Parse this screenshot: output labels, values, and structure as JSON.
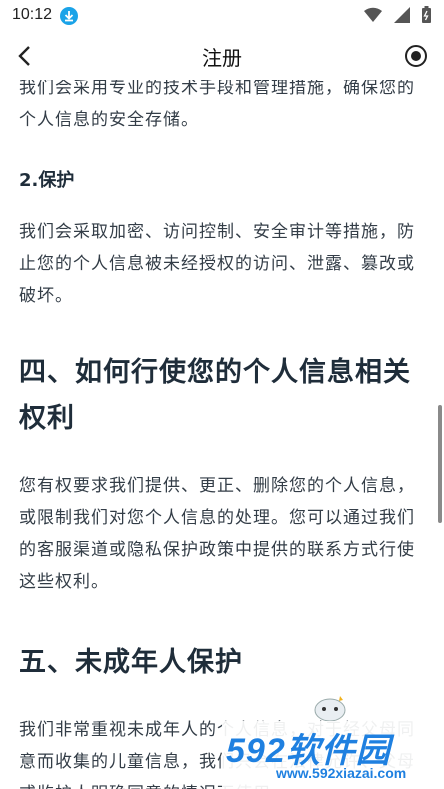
{
  "status_bar": {
    "time": "10:12"
  },
  "header": {
    "title": "注册"
  },
  "content": {
    "intro_tail": "我们会采用专业的技术手段和管理措施，确保您的个人信息的安全存储。",
    "section_protect": {
      "heading": "2.保护",
      "body": "我们会采取加密、访问控制、安全审计等措施，防止您的个人信息被未经授权的访问、泄露、篡改或破坏。"
    },
    "section_four": {
      "heading": "四、如何行使您的个人信息相关权利",
      "body": "您有权要求我们提供、更正、删除您的个人信息，或限制我们对您个人信息的处理。您可以通过我们的客服渠道或隐私保护政策中提供的联系方式行使这些权利。"
    },
    "section_five": {
      "heading": "五、未成年人保护",
      "body": "我们非常重视未成年人的个人信息，对于经父母同意而收集的儿童信息，我们只会在法律允许、父母或监护人明确同意的情况下使用。"
    }
  },
  "watermark": {
    "logo": "592软件园",
    "url": "www.592xiazai.com"
  },
  "colors": {
    "accent": "#1f80e0",
    "download_badge": "#1aa3e8",
    "text": "#333d47"
  }
}
